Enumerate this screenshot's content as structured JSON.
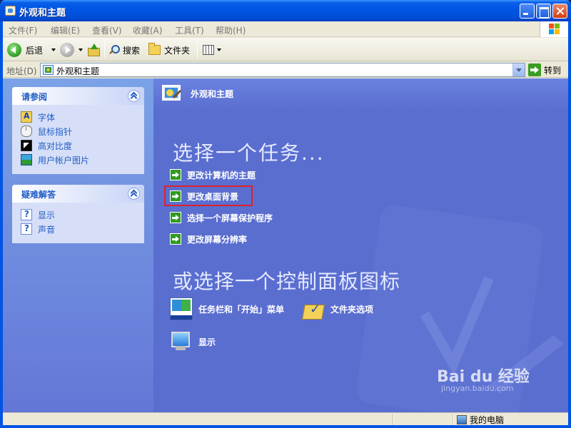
{
  "window": {
    "title": "外观和主题"
  },
  "menubar": {
    "items": [
      "文件(F)",
      "编辑(E)",
      "查看(V)",
      "收藏(A)",
      "工具(T)",
      "帮助(H)"
    ]
  },
  "toolbar": {
    "back_label": "后退",
    "search_label": "搜索",
    "folders_label": "文件夹"
  },
  "address": {
    "label": "地址(D)",
    "value": "外观和主题",
    "go_label": "转到"
  },
  "sidebar": {
    "see_also": {
      "title": "请参阅",
      "items": [
        {
          "label": "字体",
          "icon": "font-folder-icon"
        },
        {
          "label": "鼠标指针",
          "icon": "mouse-icon"
        },
        {
          "label": "高对比度",
          "icon": "contrast-icon"
        },
        {
          "label": "用户帐户图片",
          "icon": "user-picture-icon"
        }
      ]
    },
    "troubleshooters": {
      "title": "疑难解答",
      "items": [
        {
          "label": "显示",
          "icon": "help-icon"
        },
        {
          "label": "声音",
          "icon": "help-icon"
        }
      ]
    }
  },
  "main": {
    "header_title": "外观和主题",
    "task_heading": "选择一个任务...",
    "tasks": [
      "更改计算机的主题",
      "更改桌面背景",
      "选择一个屏幕保护程序",
      "更改屏幕分辨率"
    ],
    "highlighted_task_index": 1,
    "cp_heading": "或选择一个控制面板图标",
    "cp_icons": [
      {
        "label": "任务栏和「开始」菜单",
        "icon": "taskbar-icon"
      },
      {
        "label": "文件夹选项",
        "icon": "folder-options-icon"
      },
      {
        "label": "显示",
        "icon": "display-icon"
      }
    ]
  },
  "statusbar": {
    "location": "我的电脑"
  },
  "watermark": {
    "brand": "Bai du 经验",
    "sub": "jingyan.baidu.com"
  },
  "colors": {
    "titlebar": "#0054e3",
    "content_bg": "#5a6ed0",
    "sidebar_link": "#215dc6",
    "highlight_box": "#e0202a"
  }
}
